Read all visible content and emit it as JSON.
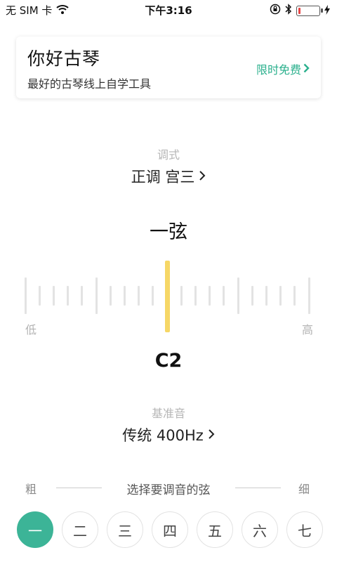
{
  "status_bar": {
    "carrier": "无 SIM 卡",
    "time": "下午3:16",
    "battery_level": 0.1,
    "colors": {
      "battery_low": "#e64545"
    }
  },
  "promo": {
    "title": "你好古琴",
    "subtitle": "最好的古琴线上自学工具",
    "cta": "限时免费"
  },
  "mode": {
    "label": "调式",
    "value": "正调 宫三"
  },
  "tuner": {
    "current_string": "一弦",
    "low_label": "低",
    "high_label": "高",
    "needle_position": 0.5,
    "note": "C2",
    "colors": {
      "needle": "#f6d766",
      "tick": "#e3e3e3"
    }
  },
  "reference": {
    "label": "基准音",
    "value": "传统 400Hz"
  },
  "string_selector": {
    "thick_label": "粗",
    "thin_label": "细",
    "title": "选择要调音的弦",
    "strings": [
      "一",
      "二",
      "三",
      "四",
      "五",
      "六",
      "七"
    ],
    "active_index": 0,
    "colors": {
      "active": "#3cb497",
      "accent": "#2bb08d"
    }
  }
}
